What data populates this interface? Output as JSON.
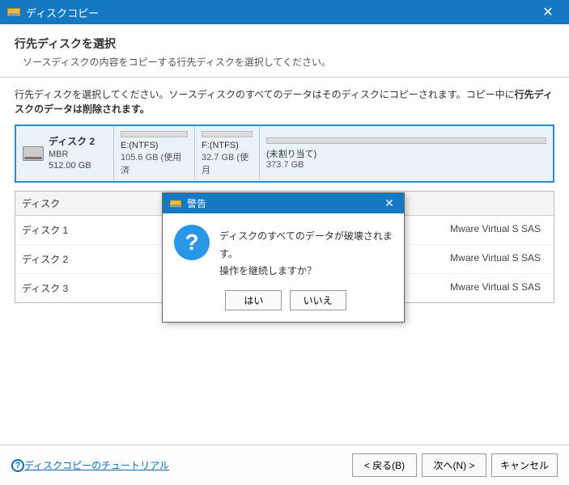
{
  "window": {
    "title": "ディスクコピー",
    "close": "✕"
  },
  "header": {
    "title": "行先ディスクを選択",
    "sub": "ソースディスクの内容をコピーする行先ディスクを選択してください。"
  },
  "instruction": {
    "pre": "行先ディスクを選択してください。ソースディスクのすべてのデータはそのディスクにコピーされます。コピー中に",
    "bold": "行先ディスクのデータは削除されます。"
  },
  "selectedDisk": {
    "name": "ディスク 2",
    "type": "MBR",
    "size": "512.00 GB",
    "parts": [
      {
        "label": "E:(NTFS)",
        "size": "105.6 GB (使用済"
      },
      {
        "label": "F:(NTFS)",
        "size": "32.7 GB (使月"
      },
      {
        "label": "(未割り当て)",
        "size": "373.7 GB"
      }
    ]
  },
  "table": {
    "head": "ディスク",
    "rows": [
      {
        "name": "ディスク 1",
        "info": "Mware Virtual S SAS"
      },
      {
        "name": "ディスク 2",
        "info": "Mware Virtual S SAS"
      },
      {
        "name": "ディスク 3",
        "info": "Mware Virtual S SAS"
      }
    ]
  },
  "footer": {
    "help": "ディスクコピーのチュートリアル",
    "back": "< 戻る(B)",
    "next": "次へ(N) >",
    "cancel": "キャンセル"
  },
  "modal": {
    "title": "警告",
    "msg1": "ディスクのすべてのデータが破壊されます。",
    "msg2": "操作を継続しますか？",
    "yes": "はい",
    "no": "いいえ",
    "close": "✕"
  }
}
